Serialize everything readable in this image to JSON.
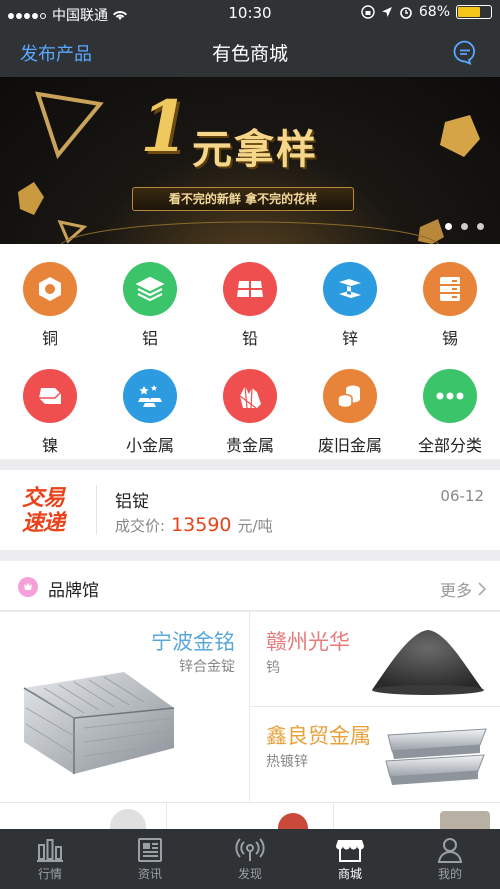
{
  "status": {
    "carrier": "中国联通",
    "time": "10:30",
    "battery": "68%"
  },
  "nav": {
    "left": "发布产品",
    "title": "有色商城"
  },
  "banner": {
    "headline": "元拿样",
    "big": "1",
    "subline": "看不完的新鲜 拿不完的花样"
  },
  "categories": [
    {
      "label": "铜",
      "icon": "hex-nut-icon",
      "color": "#e8833a"
    },
    {
      "label": "铝",
      "icon": "stack-icon",
      "color": "#3cc46b"
    },
    {
      "label": "铅",
      "icon": "ingot-grid-icon",
      "color": "#ef4f4f"
    },
    {
      "label": "锌",
      "icon": "beam-icon",
      "color": "#2d9be0"
    },
    {
      "label": "锡",
      "icon": "cabinet-icon",
      "color": "#e8833a"
    },
    {
      "label": "镍",
      "icon": "bar-icon",
      "color": "#ef4f4f"
    },
    {
      "label": "小金属",
      "icon": "gold-bars-icon",
      "color": "#2d9be0"
    },
    {
      "label": "贵金属",
      "icon": "crystal-icon",
      "color": "#ef4f4f"
    },
    {
      "label": "废旧金属",
      "icon": "coins-icon",
      "color": "#e8833a"
    },
    {
      "label": "全部分类",
      "icon": "more-dots-icon",
      "color": "#3cc46b"
    }
  ],
  "trade": {
    "logo_line1": "交易",
    "logo_line2": "速递",
    "product": "铝锭",
    "date": "06-12",
    "price_label": "成交价:",
    "price": "13590",
    "unit": "元/吨"
  },
  "brand": {
    "title": "品牌馆",
    "more": "更多",
    "items": [
      {
        "name": "宁波金铭",
        "desc": "锌合金锭",
        "color": "#5aa7d8"
      },
      {
        "name": "赣州光华",
        "desc": "钨",
        "color": "#e87a7a"
      },
      {
        "name": "鑫良贸金属",
        "desc": "热镀锌",
        "color": "#e8a03a"
      }
    ]
  },
  "tabs": [
    {
      "label": "行情",
      "icon": "bar-chart-icon"
    },
    {
      "label": "资讯",
      "icon": "news-icon"
    },
    {
      "label": "发现",
      "icon": "broadcast-icon"
    },
    {
      "label": "商城",
      "icon": "store-icon",
      "active": true
    },
    {
      "label": "我的",
      "icon": "user-icon"
    }
  ]
}
